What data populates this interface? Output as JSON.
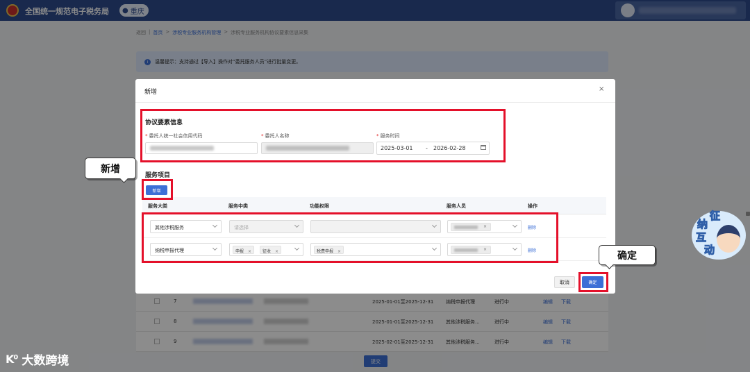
{
  "header": {
    "app_title": "全国统一规范电子税务局",
    "city": "重庆"
  },
  "breadcrumb": {
    "back": "返回",
    "items": [
      "首页",
      "涉税专业服务机构管理",
      "涉税专业服务机构协议要素信息采集"
    ]
  },
  "notice": {
    "text": "温馨提示：支持通过【导入】操作对“委托服务人员”进行批量变更。"
  },
  "background_table": {
    "rows": [
      {
        "no": "7",
        "date": "2025-01-01至2025-12-31",
        "type": "纳税申报代理",
        "status": "进行中",
        "edit": "编辑",
        "download": "下载"
      },
      {
        "no": "8",
        "date": "2025-01-01至2025-12-31",
        "type": "其他涉税服务...",
        "status": "进行中",
        "edit": "编辑",
        "download": "下载"
      },
      {
        "no": "9",
        "date": "2025-02-01至2025-12-31",
        "type": "其他涉税服务...",
        "status": "进行中",
        "edit": "编辑",
        "download": "下载"
      }
    ],
    "submit_label": "提交"
  },
  "modal": {
    "title": "新增",
    "close": "×",
    "section1": {
      "title": "协议要素信息",
      "credit_code_label": "委托人统一社会信用代码",
      "client_name_label": "委托人名称",
      "service_time_label": "服务时间",
      "date_start": "2025-03-01",
      "date_sep": "-",
      "date_end": "2026-02-28"
    },
    "section2": {
      "title": "服务项目",
      "add_label": "新增",
      "columns": [
        "服务大类",
        "服务中类",
        "功能权限",
        "服务人员",
        "操作"
      ],
      "rows": [
        {
          "category": "其他涉税服务",
          "subcategory_placeholder": "请选择",
          "subcategory_tags": [],
          "permission_tags": [],
          "action": "删除"
        },
        {
          "category": "纳税申报代理",
          "subcategory_placeholder": "",
          "subcategory_tags": [
            "申报",
            "征收"
          ],
          "permission_tags": [
            "税费申报"
          ],
          "action": "删除"
        }
      ]
    },
    "footer": {
      "cancel_label": "取消",
      "confirm_label": "确定"
    }
  },
  "annotations": {
    "callout_add": "新增",
    "callout_confirm": "确定",
    "highlight_color": "#e4102a"
  },
  "mascot": {
    "chars": [
      "征",
      "纳",
      "互",
      "动"
    ]
  },
  "watermark": {
    "logo": "K⁰",
    "text": "大数跨境"
  },
  "colors": {
    "topbar": "#2f4c8c",
    "primary": "#3c6fd6",
    "required": "#e02020"
  }
}
